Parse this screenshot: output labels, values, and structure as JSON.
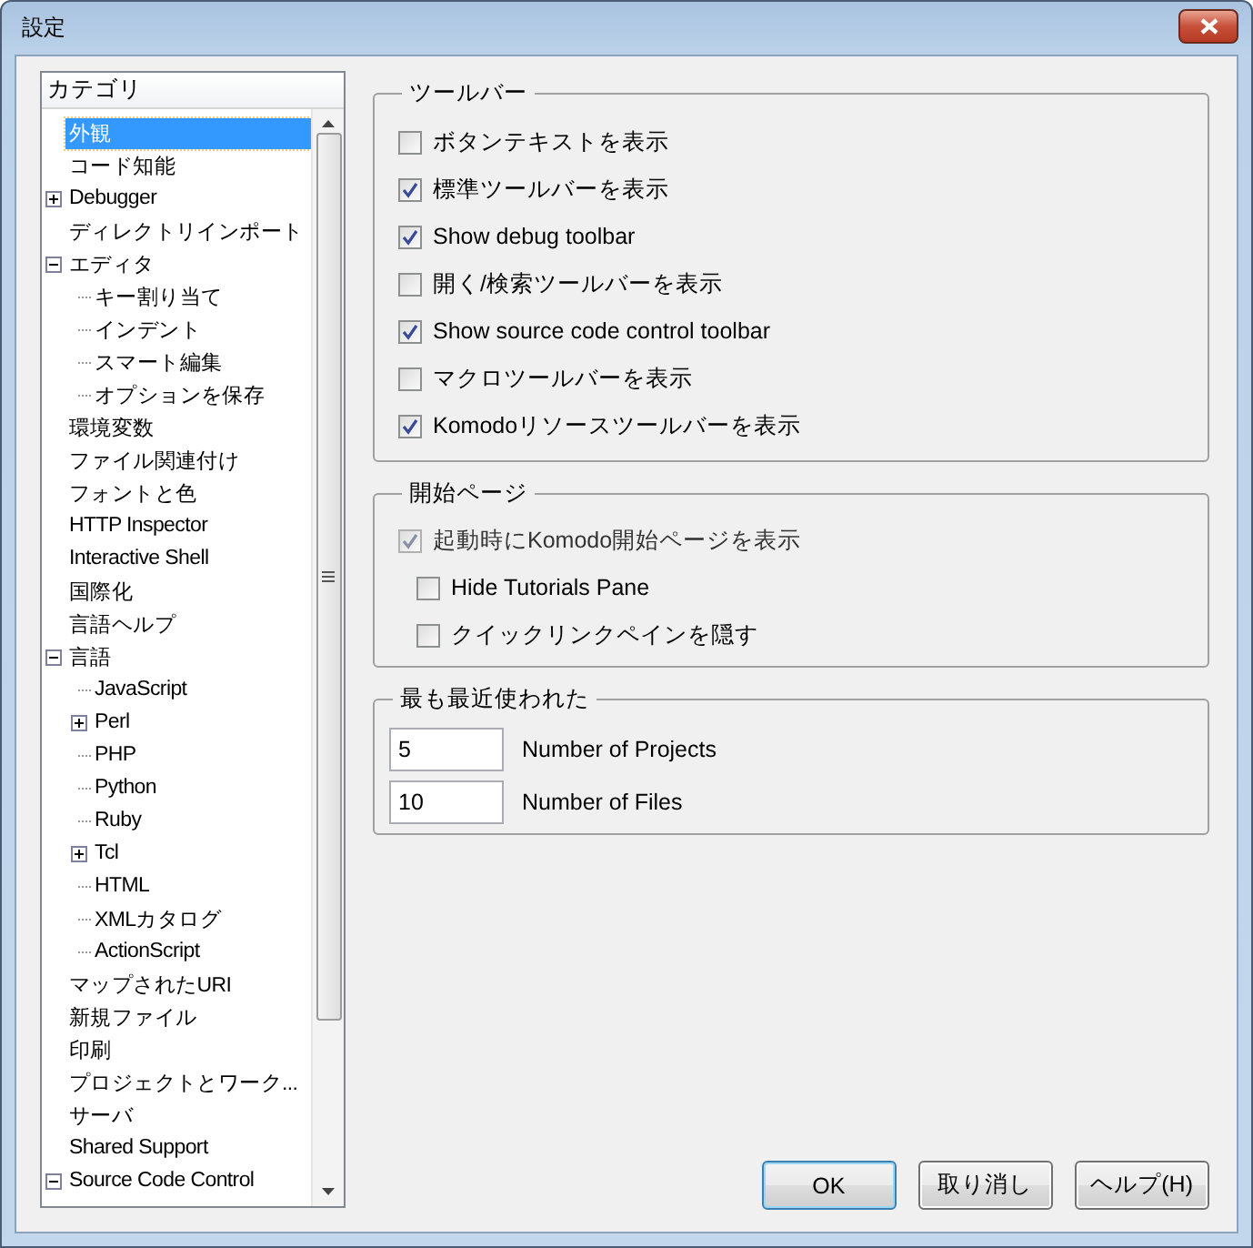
{
  "window": {
    "title": "設定"
  },
  "tree": {
    "header": "カテゴリ",
    "items": [
      {
        "label": "外観",
        "selected": true
      },
      {
        "label": "コード知能",
        "selected": false
      },
      {
        "label": "Debugger",
        "selected": false,
        "expanded": false
      },
      {
        "label": "ディレクトリインポート",
        "selected": false
      },
      {
        "label": "エディタ",
        "selected": false,
        "expanded": true,
        "children": [
          {
            "label": "キー割り当て",
            "selected": false
          },
          {
            "label": "インデント",
            "selected": false
          },
          {
            "label": "スマート編集",
            "selected": false
          },
          {
            "label": "オプションを保存",
            "selected": false
          }
        ]
      },
      {
        "label": "環境変数",
        "selected": false
      },
      {
        "label": "ファイル関連付け",
        "selected": false
      },
      {
        "label": "フォントと色",
        "selected": false
      },
      {
        "label": "HTTP Inspector",
        "selected": false
      },
      {
        "label": "Interactive Shell",
        "selected": false
      },
      {
        "label": "国際化",
        "selected": false
      },
      {
        "label": "言語ヘルプ",
        "selected": false
      },
      {
        "label": "言語",
        "selected": false,
        "expanded": true,
        "children": [
          {
            "label": "JavaScript",
            "selected": false
          },
          {
            "label": "Perl",
            "selected": false,
            "expanded": false
          },
          {
            "label": "PHP",
            "selected": false
          },
          {
            "label": "Python",
            "selected": false
          },
          {
            "label": "Ruby",
            "selected": false
          },
          {
            "label": "Tcl",
            "selected": false,
            "expanded": false
          },
          {
            "label": "HTML",
            "selected": false
          },
          {
            "label": "XMLカタログ",
            "selected": false
          },
          {
            "label": "ActionScript",
            "selected": false
          }
        ]
      },
      {
        "label": "マップされたURI",
        "selected": false
      },
      {
        "label": "新規ファイル",
        "selected": false
      },
      {
        "label": "印刷",
        "selected": false
      },
      {
        "label": "プロジェクトとワーク...",
        "selected": false
      },
      {
        "label": "サーバ",
        "selected": false
      },
      {
        "label": "Shared Support",
        "selected": false
      },
      {
        "label": "Source Code Control",
        "selected": false,
        "expanded": true
      }
    ]
  },
  "toolbar_group": {
    "title": "ツールバー",
    "options": [
      {
        "label": "ボタンテキストを表示",
        "checked": false
      },
      {
        "label": "標準ツールバーを表示",
        "checked": true
      },
      {
        "label": "Show debug toolbar",
        "checked": true
      },
      {
        "label": "開く/検索ツールバーを表示",
        "checked": false
      },
      {
        "label": "Show source code control toolbar",
        "checked": true
      },
      {
        "label": "マクロツールバーを表示",
        "checked": false
      },
      {
        "label": "Komodoリソースツールバーを表示",
        "checked": true
      }
    ]
  },
  "start_page_group": {
    "title": "開始ページ",
    "options": [
      {
        "label": "起動時にKomodo開始ページを表示",
        "checked": true,
        "disabled": true,
        "children": [
          {
            "label": "Hide Tutorials Pane",
            "checked": false,
            "disabled": false
          },
          {
            "label": "クイックリンクペインを隠す",
            "checked": false,
            "disabled": false
          }
        ]
      }
    ]
  },
  "recent_group": {
    "title": "最も最近使われた",
    "fields": [
      {
        "value": "5",
        "label": "Number of Projects"
      },
      {
        "value": "10",
        "label": "Number of Files"
      }
    ]
  },
  "buttons": [
    {
      "label": "OK",
      "default": true
    },
    {
      "label": "取り消し",
      "default": false
    },
    {
      "label": "ヘルプ(H)",
      "default": false
    }
  ]
}
